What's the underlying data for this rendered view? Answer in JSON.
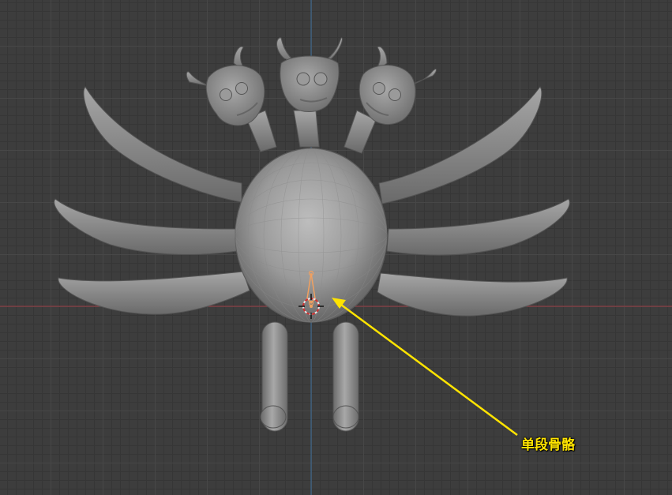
{
  "annotation": {
    "text": "单段骨骼",
    "color": "#ffe400"
  },
  "viewport": {
    "background": "#3d3d3d",
    "x_axis_color": "#9a3b42",
    "z_axis_color": "#3b6d9a"
  },
  "model": {
    "color": "#8e8e8e",
    "bone_color": "#f0a060"
  }
}
